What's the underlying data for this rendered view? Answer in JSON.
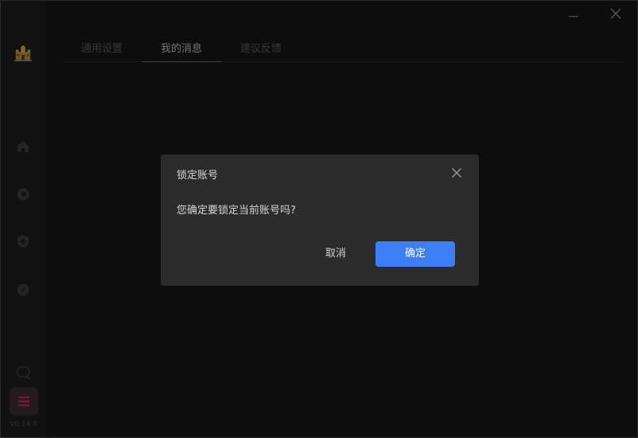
{
  "window": {
    "minimize_icon": "minimize-icon",
    "close_icon": "close-icon"
  },
  "sidebar": {
    "logo_icon": "castle-logo-icon",
    "items": [
      {
        "icon": "home-icon"
      },
      {
        "icon": "chat-bubble-icon"
      },
      {
        "icon": "shield-plus-icon"
      },
      {
        "icon": "compass-icon"
      }
    ],
    "feedback_icon": "comment-icon",
    "menu_icon": "hamburger-menu-icon",
    "version": "V6.14.8"
  },
  "tabs": [
    {
      "label": "通用设置",
      "active": false
    },
    {
      "label": "我的消息",
      "active": true
    },
    {
      "label": "建议反馈",
      "active": false
    }
  ],
  "dialog": {
    "title": "锁定账号",
    "message": "您确定要锁定当前账号吗?",
    "cancel_label": "取消",
    "confirm_label": "确定"
  },
  "colors": {
    "accent": "#3d7ef5",
    "menu_button": "#c0294f",
    "active_tab_underline": "#3a6fd8"
  }
}
